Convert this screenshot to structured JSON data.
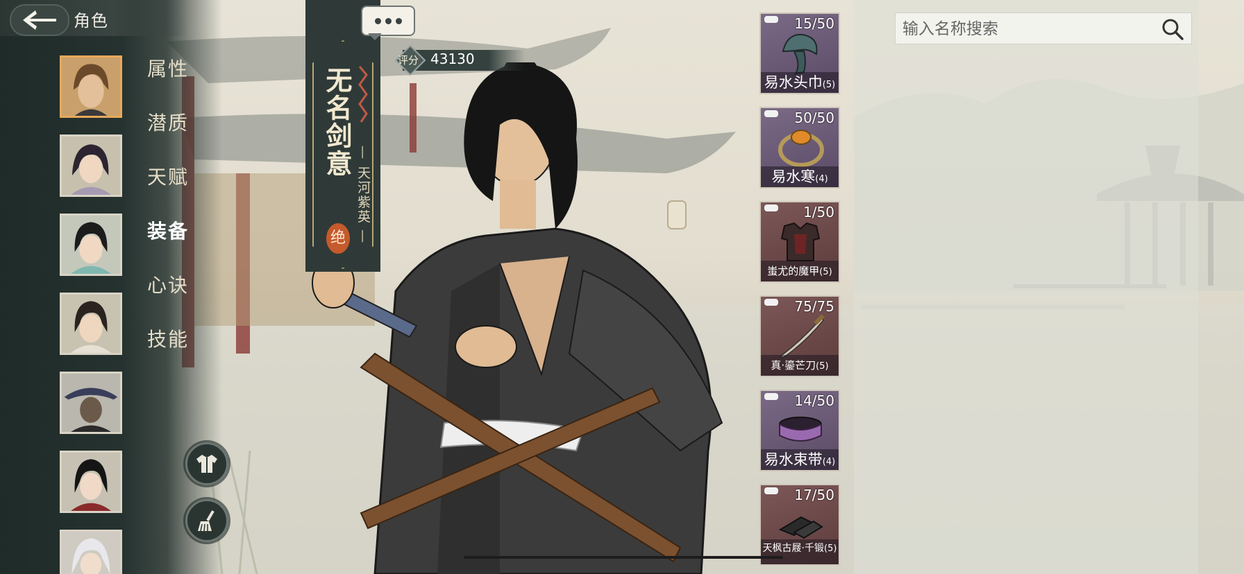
{
  "header": {
    "title": "角色",
    "back_icon": "arrow-left-icon"
  },
  "character_list": [
    {
      "id": "char-1",
      "selected": true
    },
    {
      "id": "char-2",
      "selected": false
    },
    {
      "id": "char-3",
      "selected": false
    },
    {
      "id": "char-4",
      "selected": false
    },
    {
      "id": "char-5",
      "selected": false
    },
    {
      "id": "char-6",
      "selected": false
    },
    {
      "id": "char-7",
      "selected": false
    }
  ],
  "menu": {
    "items": [
      {
        "label": "属性"
      },
      {
        "label": "潜质"
      },
      {
        "label": "天赋"
      },
      {
        "label": "装备",
        "active": true
      },
      {
        "label": "心诀"
      },
      {
        "label": "技能"
      }
    ]
  },
  "tools": {
    "outfit_icon": "robe-icon",
    "broom_icon": "broom-icon"
  },
  "banner": {
    "name": "无名剑意",
    "subtitle": "— 天河紫英 —",
    "grade": "绝"
  },
  "score": {
    "label": "评分",
    "value": "43130"
  },
  "equipment": [
    {
      "name": "易水头巾",
      "level": "(5)",
      "count": "15/50",
      "rarity": "purple",
      "icon": "headscarf-icon"
    },
    {
      "name": "易水寒",
      "level": "(4)",
      "count": "50/50",
      "rarity": "purple",
      "icon": "amber-bracelet-icon"
    },
    {
      "name": "蚩尤的魔甲",
      "level": "(5)",
      "count": "1/50",
      "rarity": "red",
      "icon": "armor-icon"
    },
    {
      "name": "真·鎏芒刀",
      "level": "(5)",
      "count": "75/75",
      "rarity": "red",
      "icon": "saber-icon"
    },
    {
      "name": "易水束带",
      "level": "(4)",
      "count": "14/50",
      "rarity": "purple",
      "icon": "belt-icon"
    },
    {
      "name": "天枫古屐·千锻",
      "level": "(5)",
      "count": "17/50",
      "rarity": "red",
      "icon": "clogs-icon"
    }
  ],
  "search": {
    "placeholder": "输入名称搜索"
  },
  "colors": {
    "panel_dark": "#25322f",
    "accent_gold": "#b9a778",
    "rarity_purple": "#6a5a76",
    "rarity_red": "#6c4848",
    "grade_seal": "#c55a2c"
  }
}
